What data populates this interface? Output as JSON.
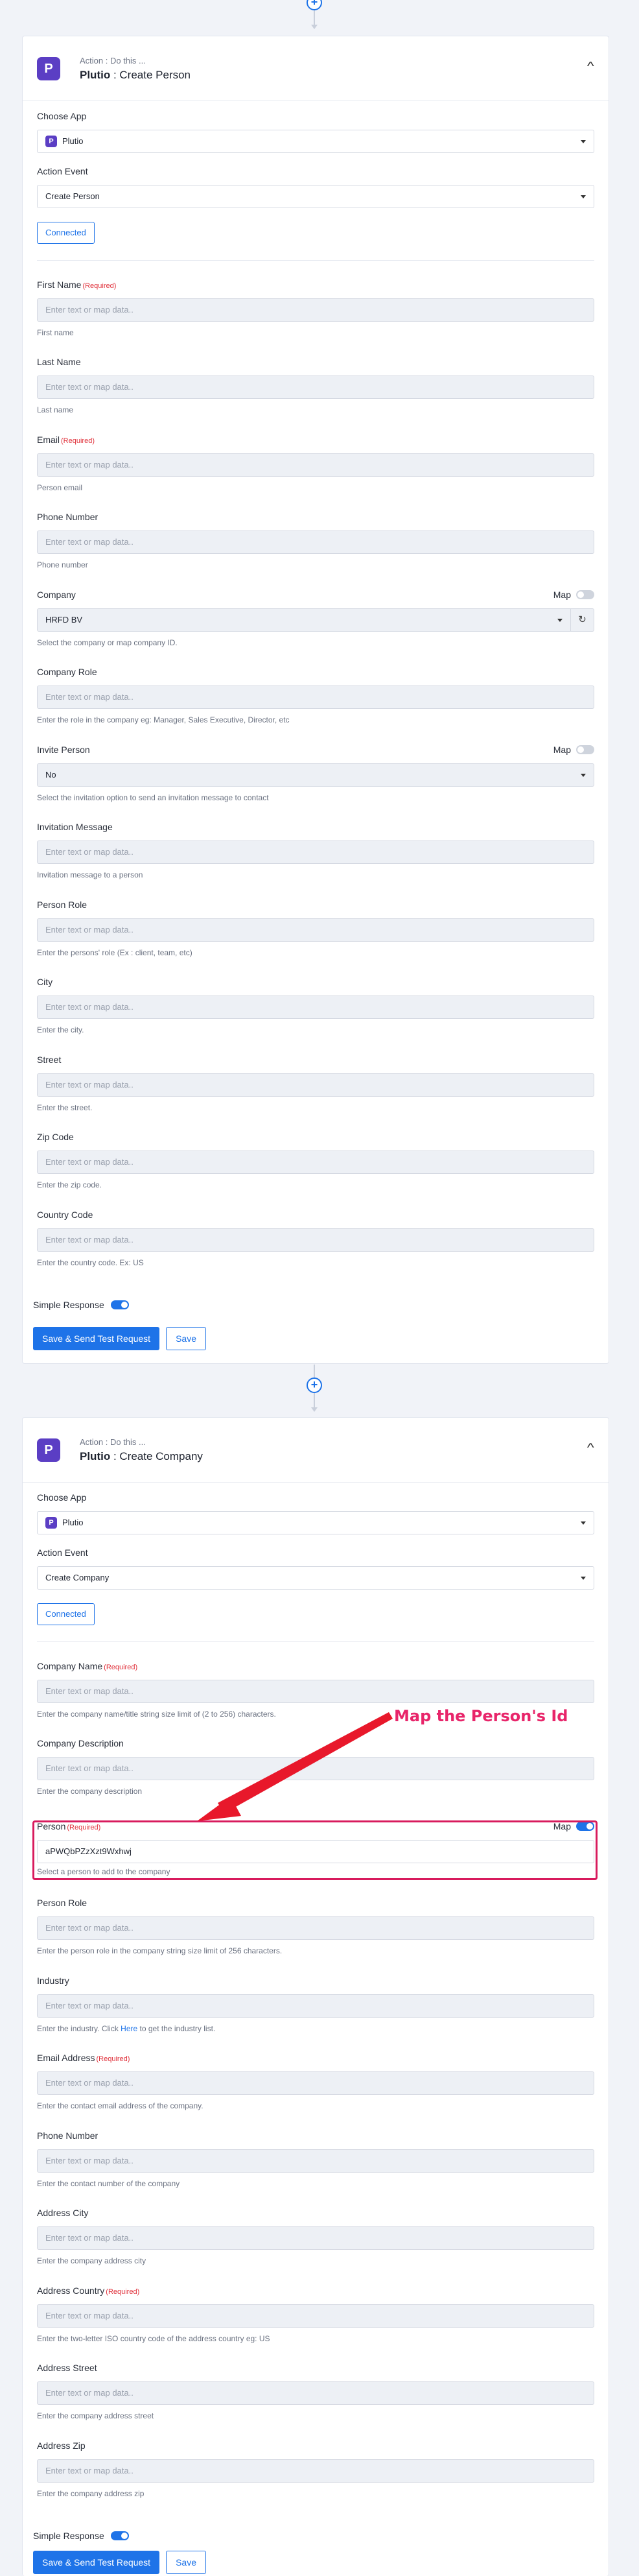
{
  "step1": {
    "subtitle": "Action : Do this ...",
    "app_name": "Plutio",
    "action_title": ": Create Person",
    "logo_letter": "P",
    "choose_app_label": "Choose App",
    "choose_app_value": "Plutio",
    "action_event_label": "Action Event",
    "action_event_value": "Create Person",
    "connected_label": "Connected",
    "fields": {
      "first_name": {
        "label": "First Name",
        "req": "(Required)",
        "placeholder": "Enter text or map data..",
        "hint": "First name"
      },
      "last_name": {
        "label": "Last Name",
        "placeholder": "Enter text or map data..",
        "hint": "Last name"
      },
      "email": {
        "label": "Email",
        "req": "(Required)",
        "placeholder": "Enter text or map data..",
        "hint": "Person email"
      },
      "phone": {
        "label": "Phone Number",
        "placeholder": "Enter text or map data..",
        "hint": "Phone number"
      },
      "company": {
        "label": "Company",
        "map": "Map",
        "value": "HRFD BV",
        "hint": "Select the company or map company ID."
      },
      "company_role": {
        "label": "Company Role",
        "placeholder": "Enter text or map data..",
        "hint": "Enter the role in the company eg: Manager, Sales Executive, Director, etc"
      },
      "invite_person": {
        "label": "Invite Person",
        "map": "Map",
        "value": "No",
        "hint": "Select the invitation option to send an invitation message to contact"
      },
      "invitation_message": {
        "label": "Invitation Message",
        "placeholder": "Enter text or map data..",
        "hint": "Invitation message to a person"
      },
      "person_role": {
        "label": "Person Role",
        "placeholder": "Enter text or map data..",
        "hint": "Enter the persons' role (Ex : client, team, etc)"
      },
      "city": {
        "label": "City",
        "placeholder": "Enter text or map data..",
        "hint": "Enter the city."
      },
      "street": {
        "label": "Street",
        "placeholder": "Enter text or map data..",
        "hint": "Enter the street."
      },
      "zip": {
        "label": "Zip Code",
        "placeholder": "Enter text or map data..",
        "hint": "Enter the zip code."
      },
      "country": {
        "label": "Country Code",
        "placeholder": "Enter text or map data..",
        "hint": "Enter the country code. Ex: US"
      }
    },
    "simple_response_label": "Simple Response",
    "save_send_label": "Save & Send Test Request",
    "save_label": "Save"
  },
  "step2": {
    "subtitle": "Action : Do this ...",
    "app_name": "Plutio",
    "action_title": ": Create Company",
    "logo_letter": "P",
    "choose_app_label": "Choose App",
    "choose_app_value": "Plutio",
    "action_event_label": "Action Event",
    "action_event_value": "Create Company",
    "connected_label": "Connected",
    "fields": {
      "company_name": {
        "label": "Company Name",
        "req": "(Required)",
        "placeholder": "Enter text or map data..",
        "hint": "Enter the company name/title string size limit of (2 to 256) characters."
      },
      "company_description": {
        "label": "Company Description",
        "placeholder": "Enter text or map data..",
        "hint": "Enter the company description"
      },
      "person": {
        "label": "Person",
        "req": "(Required)",
        "map": "Map",
        "value": "aPWQbPZzXzt9Wxhwj",
        "hint": "Select a person to add to the company"
      },
      "person_role": {
        "label": "Person Role",
        "placeholder": "Enter text or map data..",
        "hint": "Enter the person role in the company string size limit of 256 characters."
      },
      "industry": {
        "label": "Industry",
        "placeholder": "Enter text or map data..",
        "hint_pre": "Enter the industry. Click ",
        "hint_link": "Here",
        "hint_post": " to get the industry list."
      },
      "email_address": {
        "label": "Email Address",
        "req": "(Required)",
        "placeholder": "Enter text or map data..",
        "hint": "Enter the contact email address of the company."
      },
      "phone_number": {
        "label": "Phone Number",
        "placeholder": "Enter text or map data..",
        "hint": "Enter the contact number of the company"
      },
      "address_city": {
        "label": "Address City",
        "placeholder": "Enter text or map data..",
        "hint": "Enter the company address city"
      },
      "address_country": {
        "label": "Address Country",
        "req": "(Required)",
        "placeholder": "Enter text or map data..",
        "hint": "Enter the two-letter ISO country code of the address country eg: US"
      },
      "address_street": {
        "label": "Address Street",
        "placeholder": "Enter text or map data..",
        "hint": "Enter the company address street"
      },
      "address_zip": {
        "label": "Address Zip",
        "placeholder": "Enter text or map data..",
        "hint": "Enter the company address zip"
      }
    },
    "simple_response_label": "Simple Response",
    "save_send_label": "Save & Send Test Request",
    "save_label": "Save"
  },
  "annotation_text": "Map the Person's Id",
  "colors": {
    "accent": "#1e73e8",
    "brand": "#5b3ec4",
    "highlight": "#d81b5d"
  }
}
